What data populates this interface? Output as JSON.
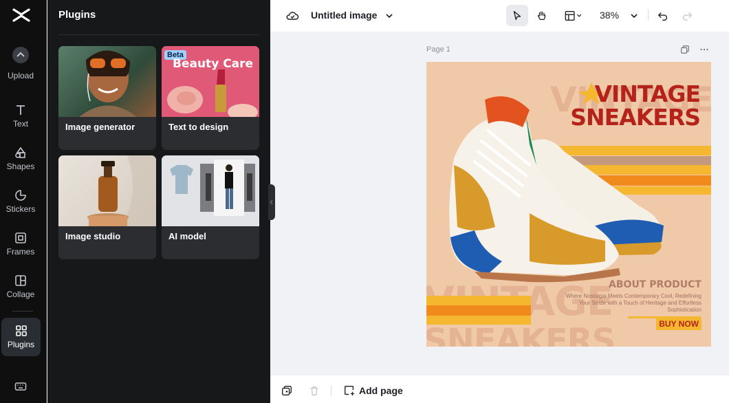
{
  "rail": {
    "items": [
      {
        "label": "Upload",
        "icon": "upload-icon"
      },
      {
        "label": "Text",
        "icon": "text-icon"
      },
      {
        "label": "Shapes",
        "icon": "shapes-icon"
      },
      {
        "label": "Stickers",
        "icon": "stickers-icon"
      },
      {
        "label": "Frames",
        "icon": "frames-icon"
      },
      {
        "label": "Collage",
        "icon": "collage-icon"
      },
      {
        "label": "Plugins",
        "icon": "plugins-icon"
      }
    ]
  },
  "panel": {
    "title": "Plugins",
    "cards": [
      {
        "label": "Image generator"
      },
      {
        "label": "Text to design",
        "badge": "Beta",
        "thumb_text": "Beauty Care"
      },
      {
        "label": "Image studio"
      },
      {
        "label": "AI model"
      }
    ]
  },
  "topbar": {
    "title": "Untitled image",
    "zoom": "38%"
  },
  "canvas": {
    "page_label": "Page 1",
    "design": {
      "headline_line1": "VINTAGE",
      "headline_line2": "SNEAKERS",
      "ghost_top": "VINTAGE",
      "ghost_bottom_1": "VINTAGE",
      "ghost_bottom_2": "SNEAKERS",
      "about_title": "ABOUT PRODUCT",
      "about_body": "Where Nostalgia Meets Contemporary Cool, Redefining Your Stride with a Touch of Heritage and Effortless Sophistication",
      "cta": "BUY NOW"
    }
  },
  "bottombar": {
    "add_page": "Add page"
  },
  "colors": {
    "accent_red": "#b5221a",
    "stripe_orange": "#f08a1c",
    "stripe_yellow": "#f5b730",
    "panel_bg": "#17181a"
  }
}
